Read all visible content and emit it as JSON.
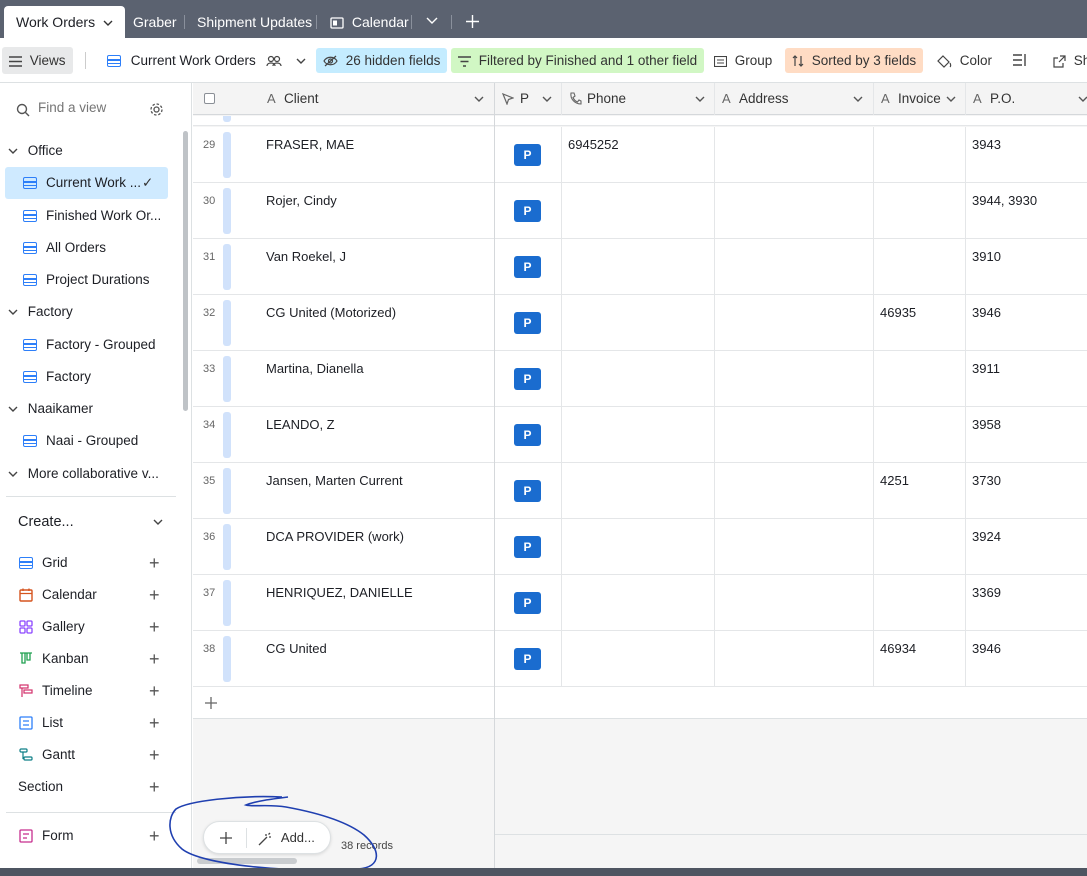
{
  "tabs": {
    "work_orders": "Work Orders",
    "graber": "Graber",
    "shipment": "Shipment Updates",
    "calendar": "Calendar"
  },
  "toolbar": {
    "views": "Views",
    "current_view": "Current Work Orders",
    "hidden": "26 hidden fields",
    "filtered": "Filtered by Finished and 1 other field",
    "group": "Group",
    "sorted": "Sorted by 3 fields",
    "color": "Color",
    "share": "Sh"
  },
  "sidebar": {
    "search_placeholder": "Find a view",
    "sec_office": "Office",
    "v_current": "Current Work ...",
    "v_finished": "Finished Work Or...",
    "v_all": "All Orders",
    "v_durations": "Project Durations",
    "sec_factory": "Factory",
    "v_factory_grouped": "Factory - Grouped",
    "v_factory": "Factory",
    "sec_naaikamer": "Naaikamer",
    "v_naai_grouped": "Naai - Grouped",
    "sec_more": "More collaborative v...",
    "create": "Create...",
    "c_grid": "Grid",
    "c_calendar": "Calendar",
    "c_gallery": "Gallery",
    "c_kanban": "Kanban",
    "c_timeline": "Timeline",
    "c_list": "List",
    "c_gantt": "Gantt",
    "c_section": "Section",
    "c_form": "Form"
  },
  "columns": {
    "client": "Client",
    "p": "P",
    "phone": "Phone",
    "address": "Address",
    "invoice": "Invoice",
    "po": "P.O."
  },
  "rows": [
    {
      "num": "29",
      "client": "FRASER, MAE",
      "badge": "P",
      "phone": "6945252",
      "invoice": "",
      "po": "3943"
    },
    {
      "num": "30",
      "client": "Rojer, Cindy",
      "badge": "P",
      "phone": "",
      "invoice": "",
      "po": "3944, 3930"
    },
    {
      "num": "31",
      "client": "Van Roekel, J",
      "badge": "P",
      "phone": "",
      "invoice": "",
      "po": "3910"
    },
    {
      "num": "32",
      "client": "CG United (Motorized)",
      "badge": "P",
      "phone": "",
      "invoice": "46935",
      "po": "3946"
    },
    {
      "num": "33",
      "client": "Martina, Dianella",
      "badge": "P",
      "phone": "",
      "invoice": "",
      "po": "3911"
    },
    {
      "num": "34",
      "client": "LEANDO, Z",
      "badge": "P",
      "phone": "",
      "invoice": "",
      "po": "3958"
    },
    {
      "num": "35",
      "client": "Jansen, Marten Current",
      "badge": "P",
      "phone": "",
      "invoice": "4251",
      "po": "3730"
    },
    {
      "num": "36",
      "client": "DCA PROVIDER (work)",
      "badge": "P",
      "phone": "",
      "invoice": "",
      "po": "3924"
    },
    {
      "num": "37",
      "client": "HENRIQUEZ, DANIELLE",
      "badge": "P",
      "phone": "",
      "invoice": "",
      "po": "3369"
    },
    {
      "num": "38",
      "client": "CG United",
      "badge": "P",
      "phone": "",
      "invoice": "46934",
      "po": "3946"
    }
  ],
  "footer": {
    "add": "Add...",
    "records": "38 records"
  },
  "colors": {
    "topbar": "#5b6270",
    "accent_blue": "#2d7ff9",
    "badge_blue": "#1a6ccf",
    "hidden_chip": "#c4ecff",
    "filter_chip": "#d1f7c4",
    "sort_chip": "#ffdcc4",
    "annotation_ink": "#1f3fb0"
  }
}
